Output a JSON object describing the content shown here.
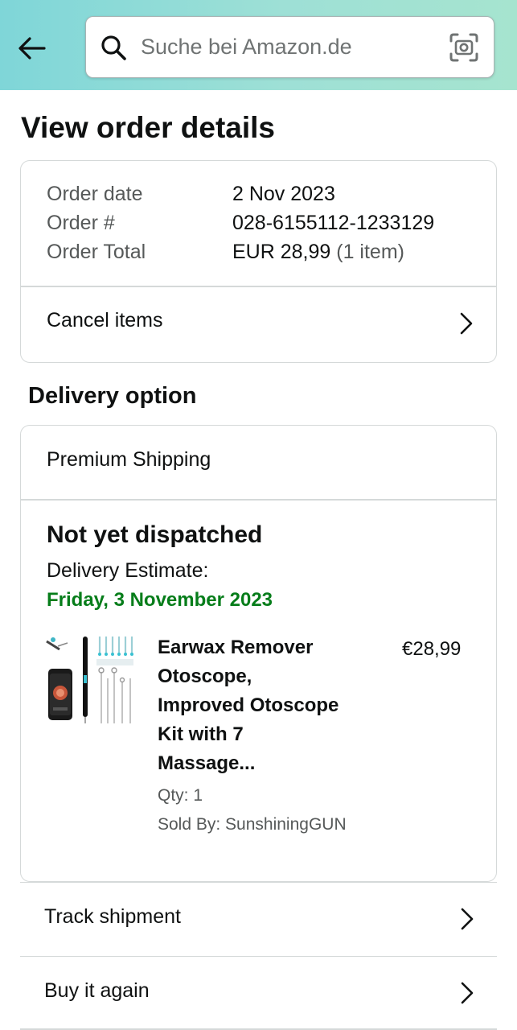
{
  "header": {
    "search_placeholder": "Suche bei Amazon.de",
    "gradient_colors": [
      "#7fd6d8",
      "#a6e4cf"
    ]
  },
  "page": {
    "title": "View order details"
  },
  "order": {
    "date_label": "Order date",
    "date_value": "2 Nov 2023",
    "number_label": "Order #",
    "number_value": "028-6155112-1233129",
    "total_label": "Order Total",
    "total_value": "EUR 28,99",
    "total_items": "(1 item)",
    "cancel_label": "Cancel items"
  },
  "delivery": {
    "section_title": "Delivery option",
    "shipping_method": "Premium Shipping",
    "status": "Not yet dispatched",
    "estimate_label": "Delivery Estimate:",
    "estimate_date": "Friday, 3 November 2023",
    "estimate_color": "#067d1a"
  },
  "product": {
    "title_lines": [
      "Earwax Remover",
      "Otoscope,",
      "Improved Otoscope",
      "Kit with 7",
      "Massage..."
    ],
    "price": "€28,99",
    "qty": "Qty: 1",
    "sold_by": "Sold By: SunshiningGUN",
    "image_icon": "otoscope-kit-product-image"
  },
  "actions": [
    {
      "label": "Track shipment"
    },
    {
      "label": "Buy it again"
    }
  ],
  "icons": {
    "back": "back-arrow-icon",
    "search": "search-icon",
    "camera": "camera-scan-icon",
    "chevron": "chevron-right-icon"
  }
}
